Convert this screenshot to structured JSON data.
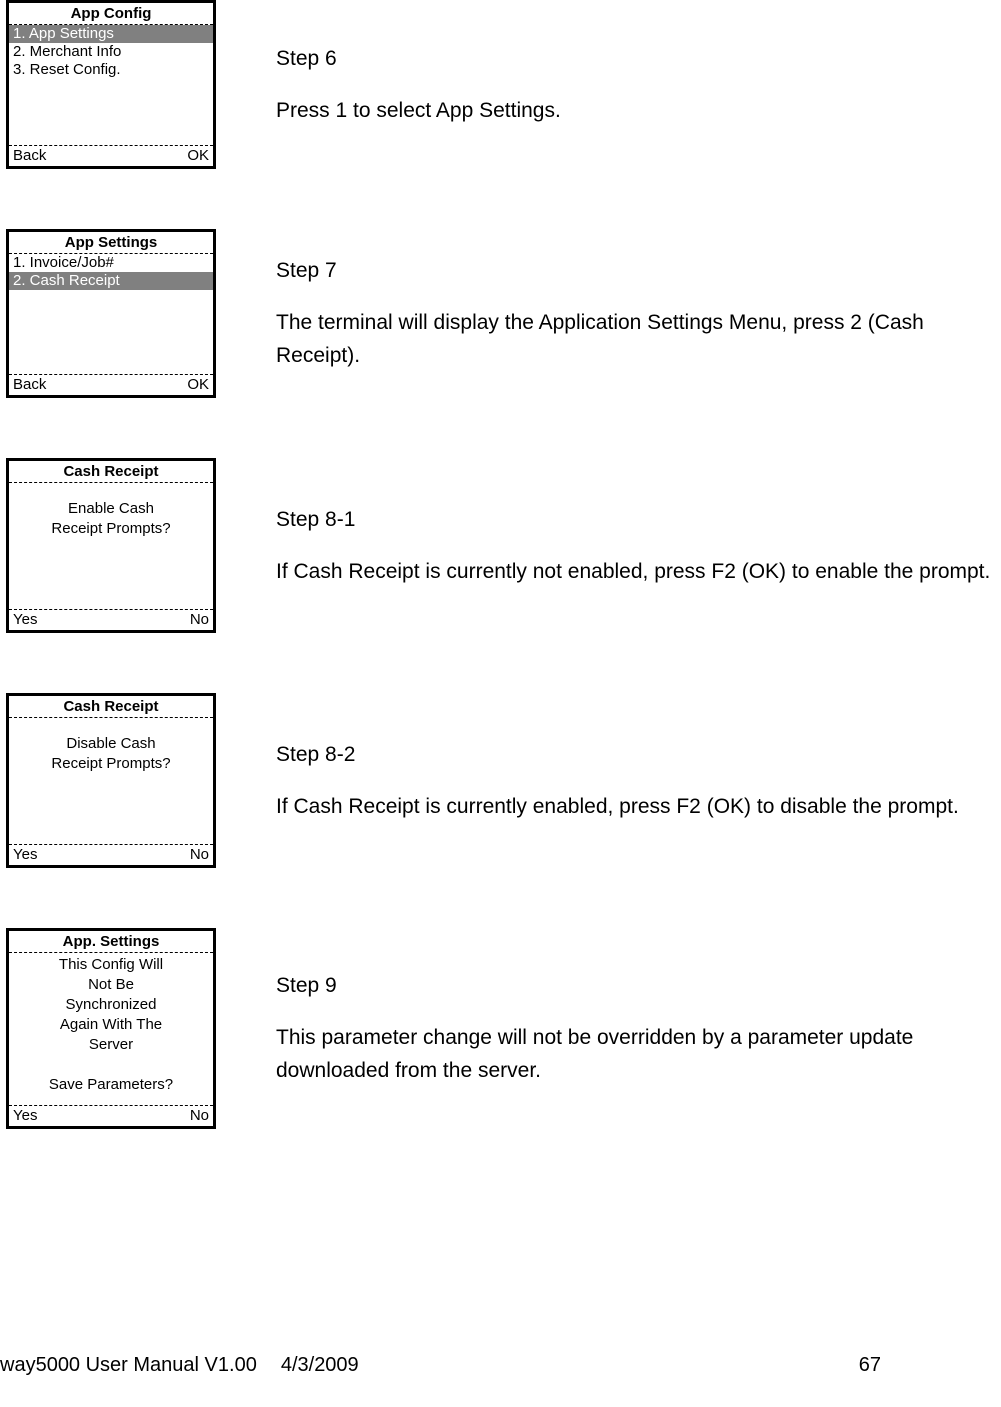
{
  "screens": [
    {
      "title": "App Config",
      "type": "menu",
      "items": [
        {
          "label": "1. App Settings",
          "selected": true
        },
        {
          "label": "2. Merchant Info",
          "selected": false
        },
        {
          "label": "3. Reset Config.",
          "selected": false
        }
      ],
      "footerLeft": "Back",
      "footerRight": "OK",
      "stepTitle": "Step 6",
      "stepText": "Press 1 to select App Settings."
    },
    {
      "title": "App Settings",
      "type": "menu",
      "items": [
        {
          "label": "1. Invoice/Job#",
          "selected": false
        },
        {
          "label": "2. Cash Receipt",
          "selected": true
        }
      ],
      "footerLeft": "Back",
      "footerRight": "OK",
      "stepTitle": "Step 7",
      "stepText": "The terminal will display the Application Settings Menu, press 2 (Cash Receipt)."
    },
    {
      "title": "Cash Receipt",
      "type": "center",
      "lines": [
        "Enable Cash",
        "Receipt Prompts?"
      ],
      "footerLeft": "Yes",
      "footerRight": "No",
      "stepTitle": "Step 8-1",
      "stepText": "If Cash Receipt is currently not enabled, press F2 (OK) to enable the prompt."
    },
    {
      "title": "Cash Receipt",
      "type": "center",
      "lines": [
        "Disable Cash",
        "Receipt Prompts?"
      ],
      "footerLeft": "Yes",
      "footerRight": "No",
      "stepTitle": "Step 8-2",
      "stepText": "If Cash Receipt is currently enabled, press F2 (OK) to disable the prompt."
    },
    {
      "title": "App. Settings",
      "type": "center",
      "lines": [
        "This Config Will",
        "Not Be",
        "Synchronized",
        "Again With The",
        "Server",
        "",
        "Save Parameters?"
      ],
      "footerLeft": "Yes",
      "footerRight": "No",
      "stepTitle": "Step 9",
      "stepText": "This parameter change will not be overridden by a parameter update downloaded from the server."
    }
  ],
  "footer": {
    "manual": "way5000 User Manual V1.00",
    "date": "4/3/2009",
    "page": "67"
  }
}
